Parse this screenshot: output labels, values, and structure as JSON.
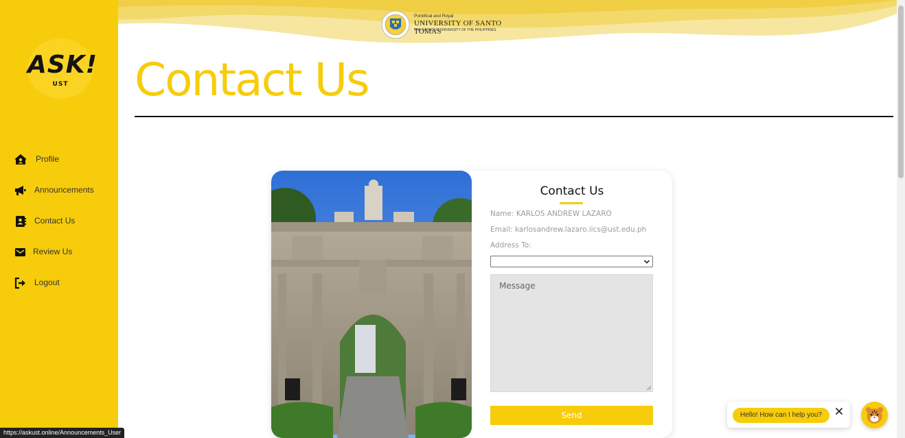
{
  "sidebar": {
    "logo_text": "ASK!",
    "logo_sub": "UST",
    "items": [
      {
        "label": "Profile",
        "icon": "home-user-icon"
      },
      {
        "label": "Announcements",
        "icon": "megaphone-icon"
      },
      {
        "label": "Contact Us",
        "icon": "contact-book-icon"
      },
      {
        "label": "Review Us",
        "icon": "envelope-icon"
      },
      {
        "label": "Logout",
        "icon": "logout-icon"
      }
    ]
  },
  "header": {
    "university_line1": "Pontifical and Royal",
    "university_line2": "UNIVERSITY OF SANTO TOMAS",
    "university_line3": "THE CATHOLIC UNIVERSITY OF THE PHILIPPINES"
  },
  "page": {
    "title": "Contact Us"
  },
  "form": {
    "title": "Contact Us",
    "name_text": "Name: KARLOS ANDREW LAZARO",
    "email_text": "Email: karlosandrew.lazaro.iics@ust.edu.ph",
    "address_label": "Address To:",
    "address_value": "",
    "message_placeholder": "Message",
    "send_label": "Send"
  },
  "chat": {
    "greeting": "Hello! How can I help you?"
  },
  "status_url": "https://askust.online/Announcements_User",
  "colors": {
    "accent": "#f7cc0b",
    "sidebar_bg": "#f7cc0b",
    "message_bg": "#e4e4e4"
  }
}
